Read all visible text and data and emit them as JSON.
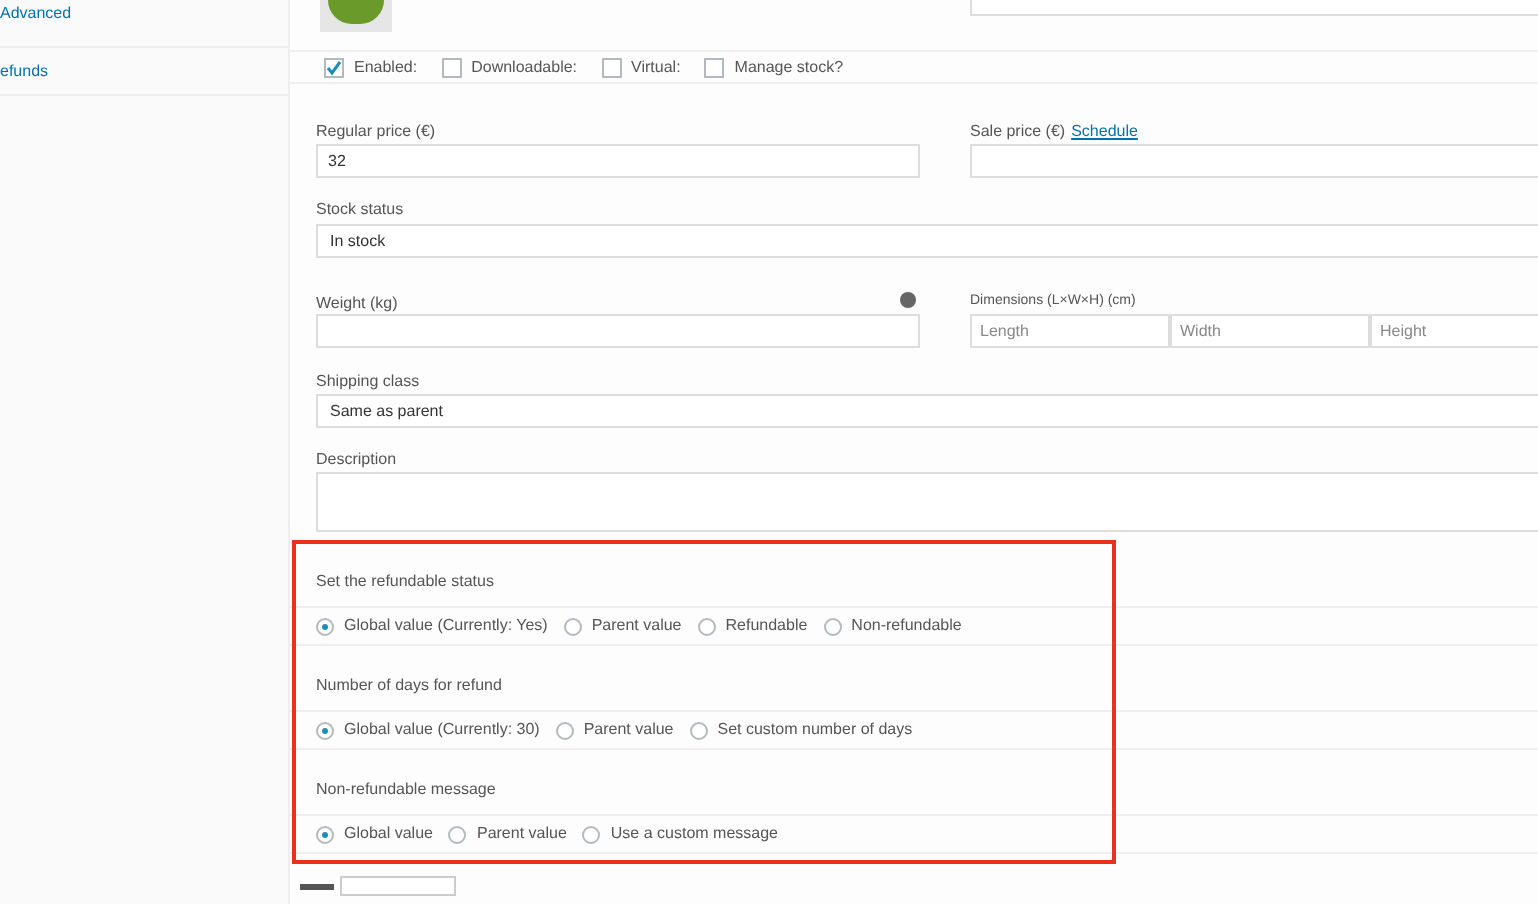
{
  "sidebar": {
    "items": [
      {
        "label": "Advanced"
      },
      {
        "label": "efunds"
      }
    ]
  },
  "variation_options": [
    {
      "label": "Enabled:",
      "checked": true
    },
    {
      "label": "Downloadable:",
      "checked": false
    },
    {
      "label": "Virtual:",
      "checked": false
    },
    {
      "label": "Manage stock?",
      "checked": false
    }
  ],
  "regular_price": {
    "label": "Regular price (€)",
    "value": "32"
  },
  "sale_price": {
    "label": "Sale price (€)",
    "link": "Schedule"
  },
  "stock_status": {
    "label": "Stock status",
    "value": "In stock"
  },
  "weight": {
    "label": "Weight (kg)"
  },
  "dimensions": {
    "label": "Dimensions (L×W×H) (cm)",
    "placeholders": [
      "Length",
      "Width",
      "Height"
    ]
  },
  "shipping_class": {
    "label": "Shipping class",
    "value": "Same as parent"
  },
  "description": {
    "label": "Description"
  },
  "refund_sections": [
    {
      "title": "Set the refundable status",
      "options": [
        {
          "label": "Global value (Currently: Yes)",
          "selected": true
        },
        {
          "label": "Parent value",
          "selected": false
        },
        {
          "label": "Refundable",
          "selected": false
        },
        {
          "label": "Non-refundable",
          "selected": false
        }
      ]
    },
    {
      "title": "Number of days for refund",
      "options": [
        {
          "label": "Global value (Currently: 30)",
          "selected": true
        },
        {
          "label": "Parent value",
          "selected": false
        },
        {
          "label": "Set custom number of days",
          "selected": false
        }
      ]
    },
    {
      "title": "Non-refundable message",
      "options": [
        {
          "label": "Global value",
          "selected": true
        },
        {
          "label": "Parent value",
          "selected": false
        },
        {
          "label": "Use a custom message",
          "selected": false
        }
      ]
    }
  ]
}
